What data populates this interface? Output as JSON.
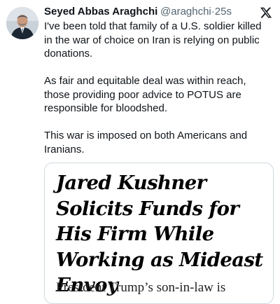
{
  "tweet": {
    "author": {
      "name": "Seyed Abbas Araghchi",
      "handle": "@araghchi",
      "separator": "·",
      "time": "25s",
      "avatar_icon": "profile-photo"
    },
    "platform_icon": "x-logo-icon",
    "paragraphs": [
      "I've been told that family of a U.S. soldier killed in the war of choice on Iran is relying on public donations.",
      "As fair and equitable deal was within reach, those providing poor advice to POTUS are responsible for bloodshed.",
      "This war is imposed on both Americans and Iranians."
    ]
  },
  "card": {
    "headline": "Jared Kushner Solicits Funds for His Firm While Working as Mideast Envoy",
    "subhead": "President Trump’s son-in-law is"
  },
  "colors": {
    "text_primary": "#0f1419",
    "text_secondary": "#536471",
    "card_border": "#cfd9de"
  }
}
